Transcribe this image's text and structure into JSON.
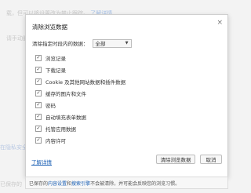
{
  "background": {
    "top_text": "载，但可以将设置改为禁止跟踪。",
    "top_link": "了解详情",
    "mid_text": "请手动删除",
    "left_link_text": "在隐私安全中",
    "bottom_left_text": "已保存的"
  },
  "dialog": {
    "title": "清除浏览数据",
    "close_glyph": "×",
    "time_range_label": "清除指定时段内的数据：",
    "time_range_value": "全部",
    "options": [
      {
        "label": "浏览记录",
        "checked": true
      },
      {
        "label": "下载记录",
        "checked": true
      },
      {
        "label": "Cookie 及其他网站数据和插件数据",
        "checked": true
      },
      {
        "label": "缓存的图片和文件",
        "checked": true
      },
      {
        "label": "密码",
        "checked": true
      },
      {
        "label": "自动填充表单数据",
        "checked": true
      },
      {
        "label": "托管应用数据",
        "checked": true
      },
      {
        "label": "内容许可",
        "checked": true
      }
    ],
    "learn_more": "了解详情",
    "clear_button": "清除浏览数据",
    "cancel_button": "取消",
    "footer": {
      "prefix": "已保存的",
      "link1": "内容设置",
      "middle": "和",
      "link2": "搜索引擎",
      "suffix": "不会被清除，并可能会反映您的浏览习惯。"
    }
  },
  "colors": {
    "link": "#1a5fb4",
    "dialog_bg": "#ffffff",
    "page_bg": "#f3f3f3"
  }
}
